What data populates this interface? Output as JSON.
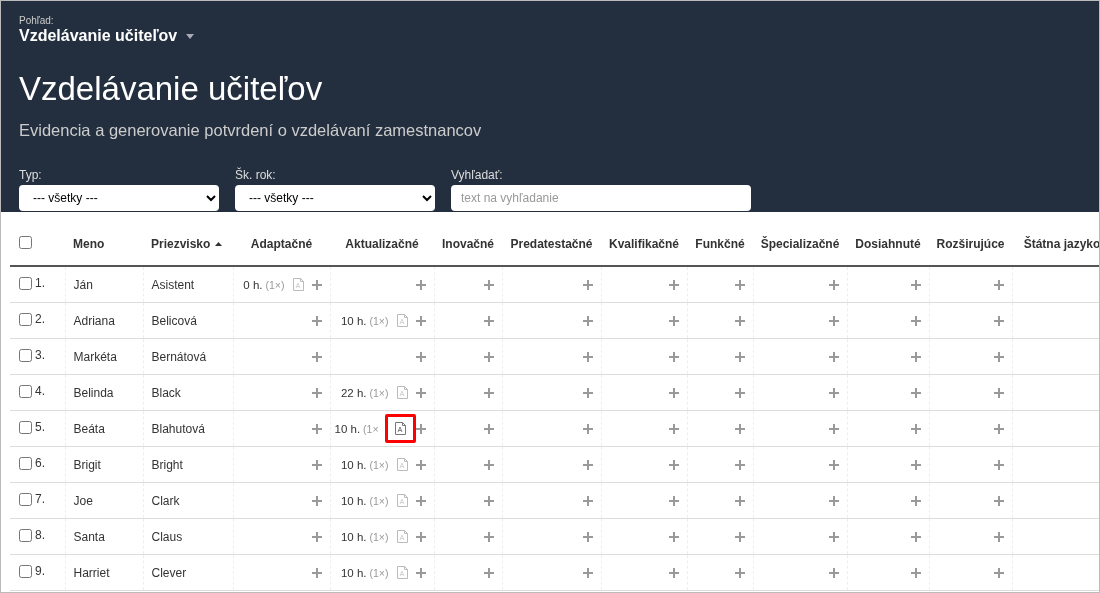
{
  "header": {
    "view_label": "Pohľad:",
    "view_name": "Vzdelávanie učiteľov",
    "title": "Vzdelávanie učiteľov",
    "subtitle": "Evidencia a generovanie potvrdení o vzdelávaní zamestnancov"
  },
  "filters": [
    {
      "kind": "select",
      "label": "Typ:",
      "value": "--- všetky ---"
    },
    {
      "kind": "select",
      "label": "Šk. rok:",
      "value": "--- všetky ---"
    },
    {
      "kind": "search",
      "label": "Vyhľadať:",
      "placeholder": "text na vyhľadanie"
    }
  ],
  "table": {
    "select_all": {
      "checked": false
    },
    "columns": [
      {
        "label": "Meno",
        "sorted": false
      },
      {
        "label": "Priezvisko",
        "sorted": true
      },
      {
        "label": "Adaptačné",
        "sorted": false
      },
      {
        "label": "Aktualizačné",
        "sorted": false
      },
      {
        "label": "Inovačné",
        "sorted": false
      },
      {
        "label": "Predatestačné",
        "sorted": false
      },
      {
        "label": "Kvalifikačné",
        "sorted": false
      },
      {
        "label": "Funkčné",
        "sorted": false
      },
      {
        "label": "Špecializačné",
        "sorted": false
      },
      {
        "label": "Dosiahnuté",
        "sorted": false
      },
      {
        "label": "Rozširujúce",
        "sorted": false
      },
      {
        "label": "Štátna jazyko",
        "sorted": false
      }
    ],
    "rows": [
      {
        "number": "1.",
        "first_name": "Ján",
        "last_name": "Asistent",
        "checked": false,
        "records": [
          {
            "kind": "record",
            "hours": "0 h.",
            "count": "(1×)",
            "highlighted": false
          },
          {
            "kind": "add"
          },
          {
            "kind": "add"
          },
          {
            "kind": "add"
          },
          {
            "kind": "add"
          },
          {
            "kind": "add"
          },
          {
            "kind": "add"
          },
          {
            "kind": "add"
          },
          {
            "kind": "add"
          }
        ]
      },
      {
        "number": "2.",
        "first_name": "Adriana",
        "last_name": "Belicová",
        "checked": false,
        "records": [
          {
            "kind": "add"
          },
          {
            "kind": "record",
            "hours": "10 h.",
            "count": "(1×)",
            "highlighted": false
          },
          {
            "kind": "add"
          },
          {
            "kind": "add"
          },
          {
            "kind": "add"
          },
          {
            "kind": "add"
          },
          {
            "kind": "add"
          },
          {
            "kind": "add"
          },
          {
            "kind": "add"
          }
        ]
      },
      {
        "number": "3.",
        "first_name": "Markéta",
        "last_name": "Bernátová",
        "checked": false,
        "records": [
          {
            "kind": "add"
          },
          {
            "kind": "add"
          },
          {
            "kind": "add"
          },
          {
            "kind": "add"
          },
          {
            "kind": "add"
          },
          {
            "kind": "add"
          },
          {
            "kind": "add"
          },
          {
            "kind": "add"
          },
          {
            "kind": "add"
          }
        ]
      },
      {
        "number": "4.",
        "first_name": "Belinda",
        "last_name": "Black",
        "checked": false,
        "records": [
          {
            "kind": "add"
          },
          {
            "kind": "record",
            "hours": "22 h.",
            "count": "(1×)",
            "highlighted": false
          },
          {
            "kind": "add"
          },
          {
            "kind": "add"
          },
          {
            "kind": "add"
          },
          {
            "kind": "add"
          },
          {
            "kind": "add"
          },
          {
            "kind": "add"
          },
          {
            "kind": "add"
          }
        ]
      },
      {
        "number": "5.",
        "first_name": "Beáta",
        "last_name": "Blahutová",
        "checked": false,
        "records": [
          {
            "kind": "add"
          },
          {
            "kind": "record",
            "hours": "10 h.",
            "count": "(1×",
            "highlighted": true
          },
          {
            "kind": "add"
          },
          {
            "kind": "add"
          },
          {
            "kind": "add"
          },
          {
            "kind": "add"
          },
          {
            "kind": "add"
          },
          {
            "kind": "add"
          },
          {
            "kind": "add"
          }
        ]
      },
      {
        "number": "6.",
        "first_name": "Brigit",
        "last_name": "Bright",
        "checked": false,
        "records": [
          {
            "kind": "add"
          },
          {
            "kind": "record",
            "hours": "10 h.",
            "count": "(1×)",
            "highlighted": false
          },
          {
            "kind": "add"
          },
          {
            "kind": "add"
          },
          {
            "kind": "add"
          },
          {
            "kind": "add"
          },
          {
            "kind": "add"
          },
          {
            "kind": "add"
          },
          {
            "kind": "add"
          }
        ]
      },
      {
        "number": "7.",
        "first_name": "Joe",
        "last_name": "Clark",
        "checked": false,
        "records": [
          {
            "kind": "add"
          },
          {
            "kind": "record",
            "hours": "10 h.",
            "count": "(1×)",
            "highlighted": false
          },
          {
            "kind": "add"
          },
          {
            "kind": "add"
          },
          {
            "kind": "add"
          },
          {
            "kind": "add"
          },
          {
            "kind": "add"
          },
          {
            "kind": "add"
          },
          {
            "kind": "add"
          }
        ]
      },
      {
        "number": "8.",
        "first_name": "Santa",
        "last_name": "Claus",
        "checked": false,
        "records": [
          {
            "kind": "add"
          },
          {
            "kind": "record",
            "hours": "10 h.",
            "count": "(1×)",
            "highlighted": false
          },
          {
            "kind": "add"
          },
          {
            "kind": "add"
          },
          {
            "kind": "add"
          },
          {
            "kind": "add"
          },
          {
            "kind": "add"
          },
          {
            "kind": "add"
          },
          {
            "kind": "add"
          }
        ]
      },
      {
        "number": "9.",
        "first_name": "Harriet",
        "last_name": "Clever",
        "checked": false,
        "records": [
          {
            "kind": "add"
          },
          {
            "kind": "record",
            "hours": "10 h.",
            "count": "(1×)",
            "highlighted": false
          },
          {
            "kind": "add"
          },
          {
            "kind": "add"
          },
          {
            "kind": "add"
          },
          {
            "kind": "add"
          },
          {
            "kind": "add"
          },
          {
            "kind": "add"
          },
          {
            "kind": "add"
          }
        ]
      }
    ]
  }
}
